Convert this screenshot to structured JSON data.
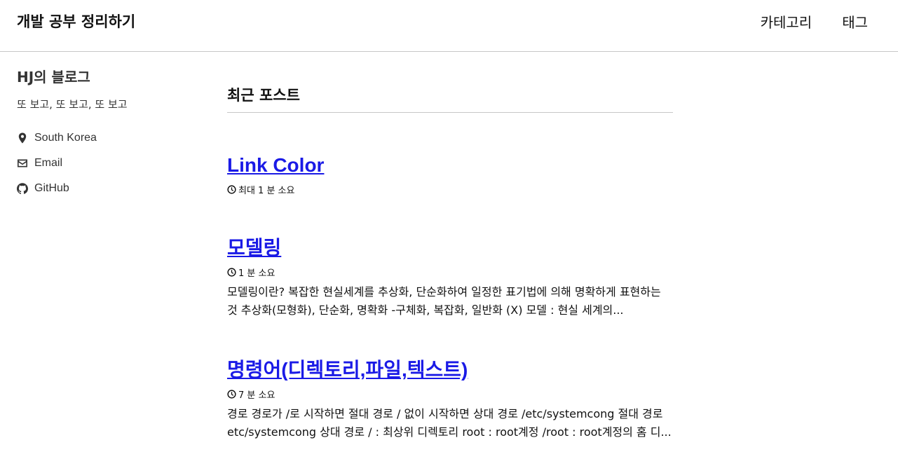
{
  "header": {
    "site_title": "개발 공부 정리하기",
    "nav": [
      {
        "label": "카테고리"
      },
      {
        "label": "태그"
      }
    ]
  },
  "sidebar": {
    "author_name": "HJ의 블로그",
    "bio": "또 보고, 또 보고, 또 보고",
    "links": [
      {
        "label": "South Korea",
        "icon": "location-pin-icon"
      },
      {
        "label": "Email",
        "icon": "envelope-icon"
      },
      {
        "label": "GitHub",
        "icon": "github-icon"
      }
    ]
  },
  "main": {
    "section_title": "최근 포스트",
    "posts": [
      {
        "title": "Link Color",
        "read_time": "최대 1 분 소요",
        "excerpt": ""
      },
      {
        "title": "모델링",
        "read_time": "1 분 소요",
        "excerpt": "모델링이란? 복잡한 현실세계를 추상화, 단순화하여 일정한 표기법에 의해 명확하게 표현하는 것 추상화(모형화), 단순화, 명확화 -구체화, 복잡화, 일반화 (X) 모델 : 현실 세계의..."
      },
      {
        "title": "명령어(디렉토리,파일,텍스트)",
        "read_time": "7 분 소요",
        "excerpt": "경로 경로가 /로 시작하면 절대 경로 / 없이 시작하면 상대 경로 /etc/systemcong 절대 경로 etc/systemcong 상대 경로 / : 최상위 디렉토리 root : root계정 /root : root계정의 홈 디..."
      }
    ]
  },
  "colors": {
    "link": "#1a1ae6",
    "divider": "#c7c7c7",
    "text": "#111111"
  }
}
